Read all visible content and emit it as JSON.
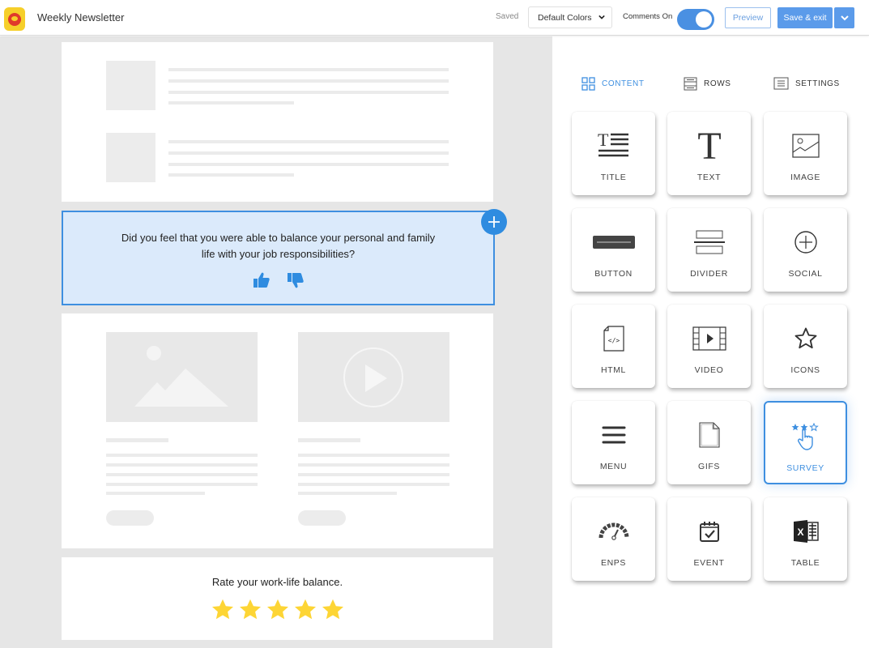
{
  "header": {
    "app_title": "Weekly Newsletter",
    "save_status": "Saved",
    "color_scheme_select": "Default Colors",
    "comments_label": "Comments On",
    "comments_enabled": true,
    "preview_label": "Preview",
    "save_exit_label": "Save & exit"
  },
  "canvas": {
    "survey_question": "Did you feel that you were able to balance your personal and family life with your job responsibilities?",
    "thumbs": [
      "thumbs-up-icon",
      "thumbs-down-icon"
    ],
    "rating_label": "Rate your work-life balance.",
    "rating_stars": 5,
    "rating_color": "#fdd535",
    "accent_color": "#3e8fe0"
  },
  "panel": {
    "tabs": [
      {
        "label": "CONTENT",
        "icon": "grid-icon",
        "active": true
      },
      {
        "label": "ROWS",
        "icon": "rows-icon",
        "active": false
      },
      {
        "label": "SETTINGS",
        "icon": "settings-icon",
        "active": false
      }
    ],
    "tiles": [
      {
        "label": "TITLE",
        "icon": "title-icon"
      },
      {
        "label": "TEXT",
        "icon": "text-icon"
      },
      {
        "label": "IMAGE",
        "icon": "image-icon"
      },
      {
        "label": "BUTTON",
        "icon": "button-icon"
      },
      {
        "label": "DIVIDER",
        "icon": "divider-icon"
      },
      {
        "label": "SOCIAL",
        "icon": "social-icon"
      },
      {
        "label": "HTML",
        "icon": "html-icon"
      },
      {
        "label": "VIDEO",
        "icon": "video-icon"
      },
      {
        "label": "ICONS",
        "icon": "star-icon"
      },
      {
        "label": "MENU",
        "icon": "menu-icon"
      },
      {
        "label": "GIFS",
        "icon": "gif-icon"
      },
      {
        "label": "SURVEY",
        "icon": "survey-icon",
        "selected": true
      },
      {
        "label": "ENPS",
        "icon": "gauge-icon"
      },
      {
        "label": "EVENT",
        "icon": "calendar-icon"
      },
      {
        "label": "TABLE",
        "icon": "excel-icon"
      }
    ]
  }
}
